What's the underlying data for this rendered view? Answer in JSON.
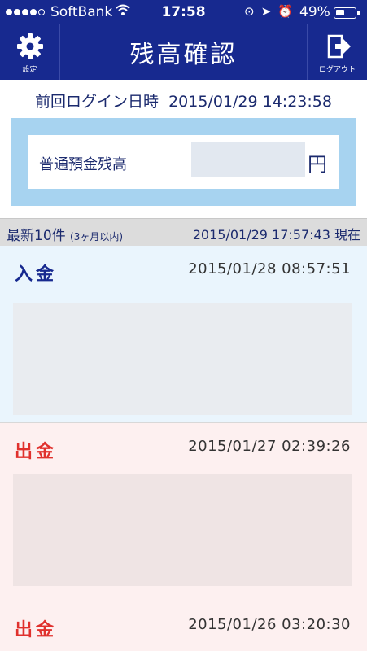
{
  "status_bar": {
    "carrier": "SoftBank",
    "time": "17:58",
    "battery_percent": "49%",
    "battery_level": 0.49,
    "signal_bars": 4,
    "icons": [
      "wifi-icon",
      "rotation-lock-icon",
      "location-icon",
      "alarm-icon"
    ]
  },
  "nav": {
    "title": "残高確認",
    "settings_label": "設定",
    "logout_label": "ログアウト"
  },
  "last_login": {
    "label": "前回ログイン日時",
    "value": "2015/01/29 14:23:58"
  },
  "balance": {
    "label": "普通預金残高",
    "unit": "円"
  },
  "list_header": {
    "title": "最新10件",
    "subtitle": "(3ヶ月以内)",
    "as_of": "2015/01/29 17:57:43 現在"
  },
  "transactions": [
    {
      "type": "入金",
      "date": "2015/01/28 08:57:51"
    },
    {
      "type": "出金",
      "date": "2015/01/27 02:39:26"
    },
    {
      "type": "出金",
      "date": "2015/01/26 03:20:30"
    }
  ],
  "colors": {
    "nav_bg": "#17298f",
    "deposit": "#17298f",
    "withdrawal": "#e0312d",
    "balance_frame": "#a7d3f0"
  }
}
